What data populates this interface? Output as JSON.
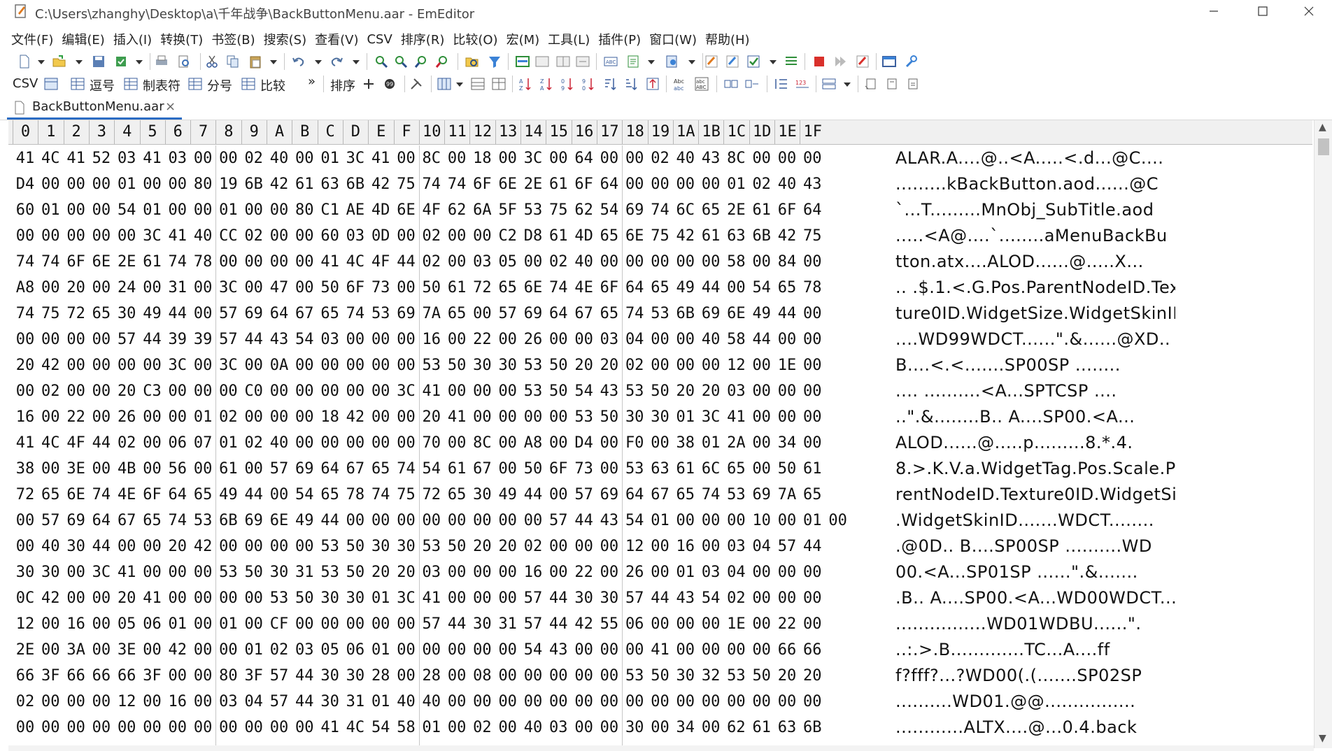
{
  "window": {
    "title": "C:\\Users\\zhanghy\\Desktop\\a\\千年战争\\BackButtonMenu.aar - EmEditor"
  },
  "menu": [
    "文件(F)",
    "编辑(E)",
    "插入(I)",
    "转换(T)",
    "书签(B)",
    "搜索(S)",
    "查看(V)",
    "CSV",
    "排序(R)",
    "比较(O)",
    "宏(M)",
    "工具(L)",
    "插件(P)",
    "窗口(W)",
    "帮助(H)"
  ],
  "toolbar2": {
    "csv": "CSV",
    "comma": "逗号",
    "tab_sep": "制表符",
    "semicolon": "分号",
    "compare": "比较",
    "more": "»",
    "sort": "排序"
  },
  "tab": {
    "label": "BackButtonMenu.aar",
    "close": "×"
  },
  "ruler": [
    "0",
    "1",
    "2",
    "3",
    "4",
    "5",
    "6",
    "7",
    "8",
    "9",
    "A",
    "B",
    "C",
    "D",
    "E",
    "F",
    "10",
    "11",
    "12",
    "13",
    "14",
    "15",
    "16",
    "17",
    "18",
    "19",
    "1A",
    "1B",
    "1C",
    "1D",
    "1E",
    "1F"
  ],
  "rows": [
    {
      "hex": [
        "41",
        "4C",
        "41",
        "52",
        "03",
        "41",
        "03",
        "00",
        "00",
        "02",
        "40",
        "00",
        "01",
        "3C",
        "41",
        "00",
        "8C",
        "00",
        "18",
        "00",
        "3C",
        "00",
        "64",
        "00",
        "00",
        "02",
        "40",
        "43",
        "8C",
        "00",
        "00",
        "00"
      ],
      "ascii": "ALAR.A....@..<A.....<.d...@C...."
    },
    {
      "hex": [
        "D4",
        "00",
        "00",
        "00",
        "01",
        "00",
        "00",
        "80",
        "19",
        "6B",
        "42",
        "61",
        "63",
        "6B",
        "42",
        "75",
        "74",
        "74",
        "6F",
        "6E",
        "2E",
        "61",
        "6F",
        "64",
        "00",
        "00",
        "00",
        "00",
        "01",
        "02",
        "40",
        "43"
      ],
      "ascii": ".........kBackButton.aod......@C"
    },
    {
      "hex": [
        "60",
        "01",
        "00",
        "00",
        "54",
        "01",
        "00",
        "00",
        "01",
        "00",
        "00",
        "80",
        "C1",
        "AE",
        "4D",
        "6E",
        "4F",
        "62",
        "6A",
        "5F",
        "53",
        "75",
        "62",
        "54",
        "69",
        "74",
        "6C",
        "65",
        "2E",
        "61",
        "6F",
        "64"
      ],
      "ascii": "`...T.........MnObj_SubTitle.aod"
    },
    {
      "hex": [
        "00",
        "00",
        "00",
        "00",
        "00",
        "3C",
        "41",
        "40",
        "CC",
        "02",
        "00",
        "00",
        "60",
        "03",
        "0D",
        "00",
        "02",
        "00",
        "00",
        "C2",
        "D8",
        "61",
        "4D",
        "65",
        "6E",
        "75",
        "42",
        "61",
        "63",
        "6B",
        "42",
        "75"
      ],
      "ascii": ".....<A@....`........aMenuBackBu"
    },
    {
      "hex": [
        "74",
        "74",
        "6F",
        "6E",
        "2E",
        "61",
        "74",
        "78",
        "00",
        "00",
        "00",
        "00",
        "41",
        "4C",
        "4F",
        "44",
        "02",
        "00",
        "03",
        "05",
        "00",
        "02",
        "40",
        "00",
        "00",
        "00",
        "00",
        "00",
        "58",
        "00",
        "84",
        "00"
      ],
      "ascii": "tton.atx....ALOD......@.....X..."
    },
    {
      "hex": [
        "A8",
        "00",
        "20",
        "00",
        "24",
        "00",
        "31",
        "00",
        "3C",
        "00",
        "47",
        "00",
        "50",
        "6F",
        "73",
        "00",
        "50",
        "61",
        "72",
        "65",
        "6E",
        "74",
        "4E",
        "6F",
        "64",
        "65",
        "49",
        "44",
        "00",
        "54",
        "65",
        "78"
      ],
      "ascii": ".. .$.1.<.G.Pos.ParentNodeID.Tex"
    },
    {
      "hex": [
        "74",
        "75",
        "72",
        "65",
        "30",
        "49",
        "44",
        "00",
        "57",
        "69",
        "64",
        "67",
        "65",
        "74",
        "53",
        "69",
        "7A",
        "65",
        "00",
        "57",
        "69",
        "64",
        "67",
        "65",
        "74",
        "53",
        "6B",
        "69",
        "6E",
        "49",
        "44",
        "00"
      ],
      "ascii": "ture0ID.WidgetSize.WidgetSkinID."
    },
    {
      "hex": [
        "00",
        "00",
        "00",
        "00",
        "57",
        "44",
        "39",
        "39",
        "57",
        "44",
        "43",
        "54",
        "03",
        "00",
        "00",
        "00",
        "16",
        "00",
        "22",
        "00",
        "26",
        "00",
        "00",
        "03",
        "04",
        "00",
        "00",
        "40",
        "58",
        "44",
        "00",
        "00"
      ],
      "ascii": "....WD99WDCT......\".&......@XD.."
    },
    {
      "hex": [
        "20",
        "42",
        "00",
        "00",
        "00",
        "00",
        "3C",
        "00",
        "3C",
        "00",
        "0A",
        "00",
        "00",
        "00",
        "00",
        "00",
        "53",
        "50",
        "30",
        "30",
        "53",
        "50",
        "20",
        "20",
        "02",
        "00",
        "00",
        "00",
        "12",
        "00",
        "1E",
        "00"
      ],
      "ascii": " B....<.<.......SP00SP  ........"
    },
    {
      "hex": [
        "00",
        "02",
        "00",
        "00",
        "20",
        "C3",
        "00",
        "00",
        "00",
        "C0",
        "00",
        "00",
        "00",
        "00",
        "00",
        "3C",
        "41",
        "00",
        "00",
        "00",
        "53",
        "50",
        "54",
        "43",
        "53",
        "50",
        "20",
        "20",
        "03",
        "00",
        "00",
        "00"
      ],
      "ascii": ".... ..........<A...SPTCSP  ...."
    },
    {
      "hex": [
        "16",
        "00",
        "22",
        "00",
        "26",
        "00",
        "00",
        "01",
        "02",
        "00",
        "00",
        "00",
        "18",
        "42",
        "00",
        "00",
        "20",
        "41",
        "00",
        "00",
        "00",
        "00",
        "53",
        "50",
        "30",
        "30",
        "01",
        "3C",
        "41",
        "00",
        "00",
        "00"
      ],
      "ascii": "..\".&........B.. A....SP00.<A..."
    },
    {
      "hex": [
        "41",
        "4C",
        "4F",
        "44",
        "02",
        "00",
        "06",
        "07",
        "01",
        "02",
        "40",
        "00",
        "00",
        "00",
        "00",
        "00",
        "70",
        "00",
        "8C",
        "00",
        "A8",
        "00",
        "D4",
        "00",
        "F0",
        "00",
        "38",
        "01",
        "2A",
        "00",
        "34",
        "00"
      ],
      "ascii": "ALOD......@.....p.........8.*.4."
    },
    {
      "hex": [
        "38",
        "00",
        "3E",
        "00",
        "4B",
        "00",
        "56",
        "00",
        "61",
        "00",
        "57",
        "69",
        "64",
        "67",
        "65",
        "74",
        "54",
        "61",
        "67",
        "00",
        "50",
        "6F",
        "73",
        "00",
        "53",
        "63",
        "61",
        "6C",
        "65",
        "00",
        "50",
        "61"
      ],
      "ascii": "8.>.K.V.a.WidgetTag.Pos.Scale.Pa"
    },
    {
      "hex": [
        "72",
        "65",
        "6E",
        "74",
        "4E",
        "6F",
        "64",
        "65",
        "49",
        "44",
        "00",
        "54",
        "65",
        "78",
        "74",
        "75",
        "72",
        "65",
        "30",
        "49",
        "44",
        "00",
        "57",
        "69",
        "64",
        "67",
        "65",
        "74",
        "53",
        "69",
        "7A",
        "65"
      ],
      "ascii": "rentNodeID.Texture0ID.WidgetSize"
    },
    {
      "hex": [
        "00",
        "57",
        "69",
        "64",
        "67",
        "65",
        "74",
        "53",
        "6B",
        "69",
        "6E",
        "49",
        "44",
        "00",
        "00",
        "00",
        "00",
        "00",
        "00",
        "00",
        "00",
        "57",
        "44",
        "43",
        "54",
        "01",
        "00",
        "00",
        "00",
        "10",
        "00",
        "01",
        "00"
      ],
      "ascii": ".WidgetSkinID.......WDCT........"
    },
    {
      "hex": [
        "00",
        "40",
        "30",
        "44",
        "00",
        "00",
        "20",
        "42",
        "00",
        "00",
        "00",
        "00",
        "53",
        "50",
        "30",
        "30",
        "53",
        "50",
        "20",
        "20",
        "02",
        "00",
        "00",
        "00",
        "12",
        "00",
        "16",
        "00",
        "03",
        "04",
        "57",
        "44"
      ],
      "ascii": ".@0D.. B....SP00SP  ..........WD"
    },
    {
      "hex": [
        "30",
        "30",
        "00",
        "3C",
        "41",
        "00",
        "00",
        "00",
        "53",
        "50",
        "30",
        "31",
        "53",
        "50",
        "20",
        "20",
        "03",
        "00",
        "00",
        "00",
        "16",
        "00",
        "22",
        "00",
        "26",
        "00",
        "01",
        "03",
        "04",
        "00",
        "00",
        "00"
      ],
      "ascii": "00.<A...SP01SP  ......\".&......."
    },
    {
      "hex": [
        "0C",
        "42",
        "00",
        "00",
        "20",
        "41",
        "00",
        "00",
        "00",
        "00",
        "53",
        "50",
        "30",
        "30",
        "01",
        "3C",
        "41",
        "00",
        "00",
        "00",
        "57",
        "44",
        "30",
        "30",
        "57",
        "44",
        "43",
        "54",
        "02",
        "00",
        "00",
        "00"
      ],
      "ascii": ".B.. A....SP00.<A...WD00WDCT...."
    },
    {
      "hex": [
        "12",
        "00",
        "16",
        "00",
        "05",
        "06",
        "01",
        "00",
        "01",
        "00",
        "CF",
        "00",
        "00",
        "00",
        "00",
        "00",
        "57",
        "44",
        "30",
        "31",
        "57",
        "44",
        "42",
        "55",
        "06",
        "00",
        "00",
        "00",
        "1E",
        "00",
        "22",
        "00"
      ],
      "ascii": "................WD01WDBU......\"."
    },
    {
      "hex": [
        "2E",
        "00",
        "3A",
        "00",
        "3E",
        "00",
        "42",
        "00",
        "00",
        "01",
        "02",
        "03",
        "05",
        "06",
        "01",
        "00",
        "00",
        "00",
        "00",
        "00",
        "54",
        "43",
        "00",
        "00",
        "00",
        "41",
        "00",
        "00",
        "00",
        "00",
        "66",
        "66"
      ],
      "ascii": "..:.>.B.............TC...A....ff"
    },
    {
      "hex": [
        "66",
        "3F",
        "66",
        "66",
        "66",
        "3F",
        "00",
        "00",
        "80",
        "3F",
        "57",
        "44",
        "30",
        "30",
        "28",
        "00",
        "28",
        "00",
        "08",
        "00",
        "00",
        "00",
        "00",
        "00",
        "53",
        "50",
        "30",
        "32",
        "53",
        "50",
        "20",
        "20"
      ],
      "ascii": "f?fff?...?WD00(.(.......SP02SP  "
    },
    {
      "hex": [
        "02",
        "00",
        "00",
        "00",
        "12",
        "00",
        "16",
        "00",
        "03",
        "04",
        "57",
        "44",
        "30",
        "31",
        "01",
        "40",
        "40",
        "00",
        "00",
        "00",
        "00",
        "00",
        "00",
        "00",
        "00",
        "00",
        "00",
        "00",
        "00",
        "00",
        "00",
        "00"
      ],
      "ascii": "..........WD01.@@................"
    },
    {
      "hex": [
        "00",
        "00",
        "00",
        "00",
        "00",
        "00",
        "00",
        "00",
        "00",
        "00",
        "00",
        "00",
        "41",
        "4C",
        "54",
        "58",
        "01",
        "00",
        "02",
        "00",
        "40",
        "03",
        "00",
        "00",
        "30",
        "00",
        "34",
        "00",
        "62",
        "61",
        "63",
        "6B"
      ],
      "ascii": "............ALTX....@...0.4.back"
    }
  ]
}
